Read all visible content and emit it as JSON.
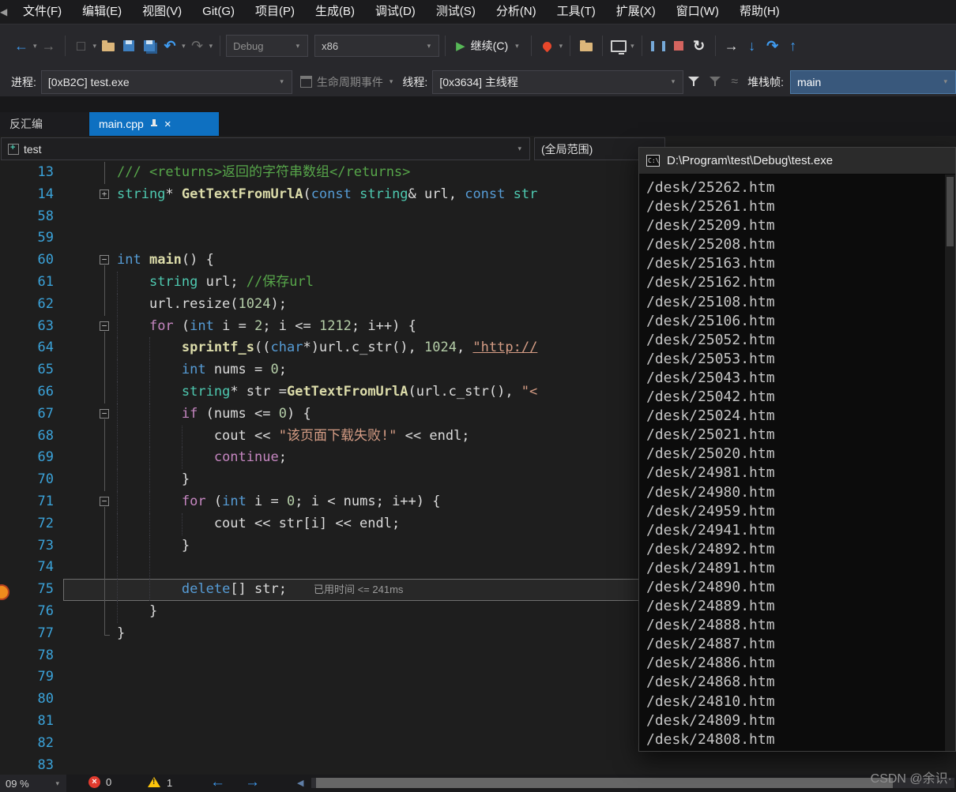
{
  "menu": {
    "items": [
      "文件(F)",
      "编辑(E)",
      "视图(V)",
      "Git(G)",
      "项目(P)",
      "生成(B)",
      "调试(D)",
      "测试(S)",
      "分析(N)",
      "工具(T)",
      "扩展(X)",
      "窗口(W)",
      "帮助(H)"
    ]
  },
  "toolbar": {
    "debug_target": "Debug",
    "platform": "x86",
    "continue_label": "继续(C)"
  },
  "debug_bar": {
    "process_label": "进程:",
    "process_value": "[0xB2C] test.exe",
    "lifecycle_label": "生命周期事件",
    "thread_label": "线程:",
    "thread_value": "[0x3634] 主线程",
    "stack_frame_label": "堆栈帧:",
    "stack_frame_value": "main"
  },
  "tabs": {
    "left_partial": "反汇编",
    "active": {
      "label": "main.cpp"
    }
  },
  "navbar": {
    "project": "test",
    "scope": "(全局范围)"
  },
  "editor": {
    "perf_tip": "已用时间 <= 241ms",
    "lines": [
      {
        "n": "13",
        "out": "line",
        "toks": [
          [
            "comment",
            "/// <returns>返回的字符串数组</returns>"
          ]
        ]
      },
      {
        "n": "14",
        "out": "plus",
        "toks": [
          [
            "type",
            "string"
          ],
          [
            "plain",
            "* "
          ],
          [
            "func",
            "GetTextFromUrlA"
          ],
          [
            "plain",
            "("
          ],
          [
            "kw",
            "const"
          ],
          [
            "plain",
            " "
          ],
          [
            "type",
            "string"
          ],
          [
            "plain",
            "& url, "
          ],
          [
            "kw",
            "const"
          ],
          [
            "plain",
            " "
          ],
          [
            "type",
            "str"
          ]
        ]
      },
      {
        "n": "58",
        "toks": []
      },
      {
        "n": "59",
        "toks": []
      },
      {
        "n": "60",
        "out": "minus",
        "toks": [
          [
            "kw",
            "int"
          ],
          [
            "plain",
            " "
          ],
          [
            "func",
            "main"
          ],
          [
            "plain",
            "() {"
          ]
        ]
      },
      {
        "n": "61",
        "out": "line",
        "guides": [
          0
        ],
        "toks": [
          [
            "plain",
            "    "
          ],
          [
            "type",
            "string"
          ],
          [
            "plain",
            " url; "
          ],
          [
            "comment",
            "//保存url"
          ]
        ]
      },
      {
        "n": "62",
        "out": "line",
        "guides": [
          0
        ],
        "toks": [
          [
            "plain",
            "    url.resize("
          ],
          [
            "num",
            "1024"
          ],
          [
            "plain",
            ");"
          ]
        ]
      },
      {
        "n": "63",
        "out": "minus",
        "guides": [
          0
        ],
        "toks": [
          [
            "plain",
            "    "
          ],
          [
            "ctrl",
            "for"
          ],
          [
            "plain",
            " ("
          ],
          [
            "kw",
            "int"
          ],
          [
            "plain",
            " i = "
          ],
          [
            "num",
            "2"
          ],
          [
            "plain",
            "; i <= "
          ],
          [
            "num",
            "1212"
          ],
          [
            "plain",
            "; i++) {"
          ]
        ]
      },
      {
        "n": "64",
        "out": "line",
        "guides": [
          0,
          4
        ],
        "toks": [
          [
            "plain",
            "        "
          ],
          [
            "func",
            "sprintf_s"
          ],
          [
            "plain",
            "(("
          ],
          [
            "kw",
            "char"
          ],
          [
            "plain",
            "*)url.c_str(), "
          ],
          [
            "num",
            "1024"
          ],
          [
            "plain",
            ", "
          ],
          [
            "strlink",
            "\"http://"
          ]
        ]
      },
      {
        "n": "65",
        "out": "line",
        "guides": [
          0,
          4
        ],
        "toks": [
          [
            "plain",
            "        "
          ],
          [
            "kw",
            "int"
          ],
          [
            "plain",
            " nums = "
          ],
          [
            "num",
            "0"
          ],
          [
            "plain",
            ";"
          ]
        ]
      },
      {
        "n": "66",
        "out": "line",
        "guides": [
          0,
          4
        ],
        "toks": [
          [
            "plain",
            "        "
          ],
          [
            "type",
            "string"
          ],
          [
            "plain",
            "* str ="
          ],
          [
            "func",
            "GetTextFromUrlA"
          ],
          [
            "plain",
            "(url.c_str(), "
          ],
          [
            "str",
            "\"<"
          ]
        ]
      },
      {
        "n": "67",
        "out": "minus",
        "guides": [
          0,
          4
        ],
        "toks": [
          [
            "plain",
            "        "
          ],
          [
            "ctrl",
            "if"
          ],
          [
            "plain",
            " (nums <= "
          ],
          [
            "num",
            "0"
          ],
          [
            "plain",
            ") {"
          ]
        ]
      },
      {
        "n": "68",
        "out": "line",
        "guides": [
          0,
          4,
          8
        ],
        "toks": [
          [
            "plain",
            "            cout << "
          ],
          [
            "str",
            "\"该页面下载失败!\""
          ],
          [
            "plain",
            " << endl;"
          ]
        ]
      },
      {
        "n": "69",
        "out": "line",
        "guides": [
          0,
          4,
          8
        ],
        "toks": [
          [
            "plain",
            "            "
          ],
          [
            "ctrl",
            "continue"
          ],
          [
            "plain",
            ";"
          ]
        ]
      },
      {
        "n": "70",
        "out": "line",
        "guides": [
          0,
          4
        ],
        "toks": [
          [
            "plain",
            "        }"
          ]
        ]
      },
      {
        "n": "71",
        "out": "minus",
        "guides": [
          0,
          4
        ],
        "toks": [
          [
            "plain",
            "        "
          ],
          [
            "ctrl",
            "for"
          ],
          [
            "plain",
            " ("
          ],
          [
            "kw",
            "int"
          ],
          [
            "plain",
            " i = "
          ],
          [
            "num",
            "0"
          ],
          [
            "plain",
            "; i < nums; i++) {"
          ]
        ]
      },
      {
        "n": "72",
        "out": "line",
        "guides": [
          0,
          4,
          8
        ],
        "toks": [
          [
            "plain",
            "            cout << str[i] << endl;"
          ]
        ]
      },
      {
        "n": "73",
        "out": "line",
        "guides": [
          0,
          4
        ],
        "toks": [
          [
            "plain",
            "        }"
          ]
        ]
      },
      {
        "n": "74",
        "out": "line",
        "guides": [
          0,
          4
        ],
        "toks": []
      },
      {
        "n": "75",
        "out": "line",
        "guides": [
          0,
          4
        ],
        "cur": true,
        "tip": true,
        "toks": [
          [
            "plain",
            "        "
          ],
          [
            "kw",
            "delete"
          ],
          [
            "plain",
            "[] str;"
          ]
        ]
      },
      {
        "n": "76",
        "out": "line",
        "guides": [
          0
        ],
        "toks": [
          [
            "plain",
            "    }"
          ]
        ]
      },
      {
        "n": "77",
        "out": "end",
        "toks": [
          [
            "plain",
            "}"
          ]
        ]
      },
      {
        "n": "78",
        "toks": []
      },
      {
        "n": "79",
        "toks": []
      },
      {
        "n": "80",
        "toks": []
      },
      {
        "n": "81",
        "toks": []
      },
      {
        "n": "82",
        "toks": []
      },
      {
        "n": "83",
        "toks": []
      }
    ]
  },
  "console": {
    "title": "D:\\Program\\test\\Debug\\test.exe",
    "lines": [
      "/desk/25262.htm",
      "/desk/25261.htm",
      "/desk/25209.htm",
      "/desk/25208.htm",
      "/desk/25163.htm",
      "/desk/25162.htm",
      "/desk/25108.htm",
      "/desk/25106.htm",
      "/desk/25052.htm",
      "/desk/25053.htm",
      "/desk/25043.htm",
      "/desk/25042.htm",
      "/desk/25024.htm",
      "/desk/25021.htm",
      "/desk/25020.htm",
      "/desk/24981.htm",
      "/desk/24980.htm",
      "/desk/24959.htm",
      "/desk/24941.htm",
      "/desk/24892.htm",
      "/desk/24891.htm",
      "/desk/24890.htm",
      "/desk/24889.htm",
      "/desk/24888.htm",
      "/desk/24887.htm",
      "/desk/24886.htm",
      "/desk/24868.htm",
      "/desk/24810.htm",
      "/desk/24809.htm",
      "/desk/24808.htm"
    ]
  },
  "status": {
    "zoom": "09 %",
    "error_count": "0",
    "warning_count": "1"
  },
  "watermark": "CSDN @余识·",
  "colors": {
    "accent": "#007acc",
    "tab_active": "#0e70c1",
    "keyword": "#569cd6",
    "control_keyword": "#c586c0",
    "type": "#4ec9b0",
    "function": "#dcdcaa",
    "string": "#d69d85",
    "comment": "#57a64a",
    "number": "#b5cea8",
    "line_number": "#3ba3da",
    "console_bg": "#0c0c0c"
  },
  "icons": {
    "app": "◀",
    "back": "←",
    "forward": "→",
    "caret": "▾",
    "new-file": "□",
    "undo": "↶",
    "redo": "↷",
    "play": "▶",
    "restart": "↻",
    "show-next": "→",
    "step-into": "↓",
    "step-over": "↷",
    "step-out": "↑",
    "close": "×",
    "scroll-left": "◀",
    "console": "C:\\",
    "wave": "≈"
  }
}
